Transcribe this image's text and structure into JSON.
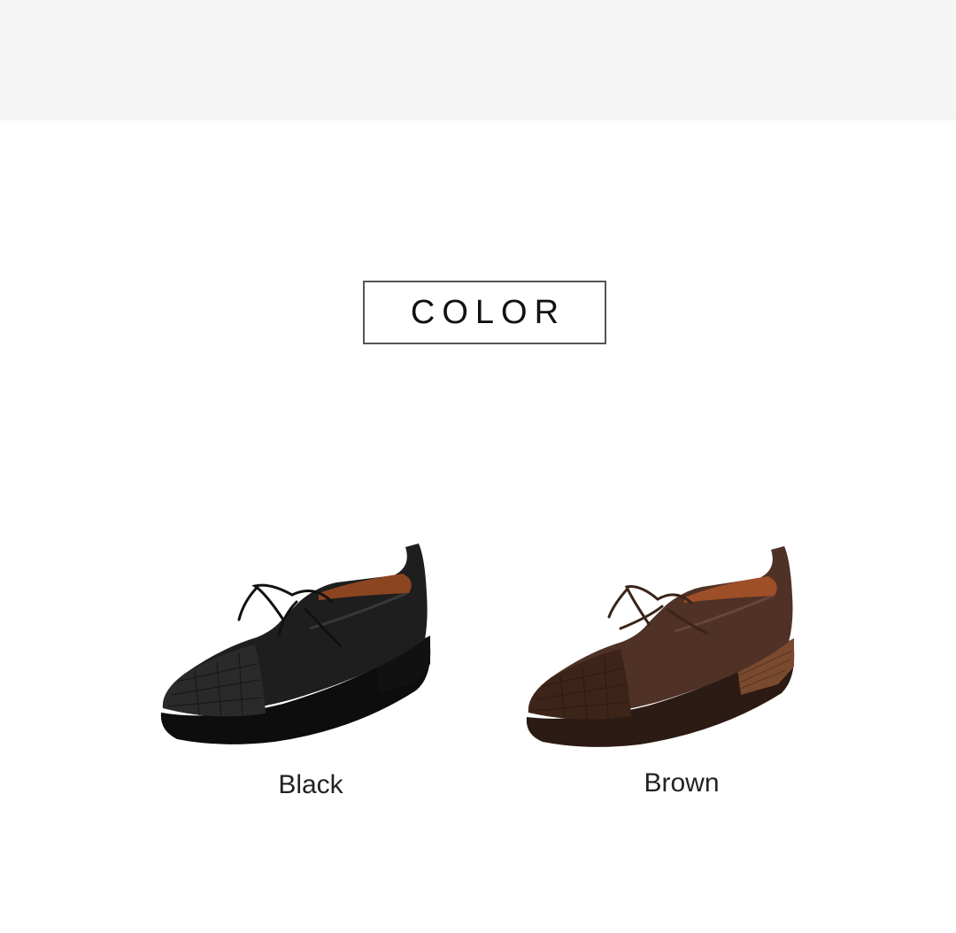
{
  "section": {
    "title": "COLOR"
  },
  "products": [
    {
      "label": "Black",
      "color": "#1b1b1b",
      "lining": "#9a4a22"
    },
    {
      "label": "Brown",
      "color": "#4a2e24",
      "lining": "#a8552a"
    }
  ],
  "colors": {
    "band": "#f5f5f5",
    "border": "#555555",
    "text": "#222222"
  }
}
